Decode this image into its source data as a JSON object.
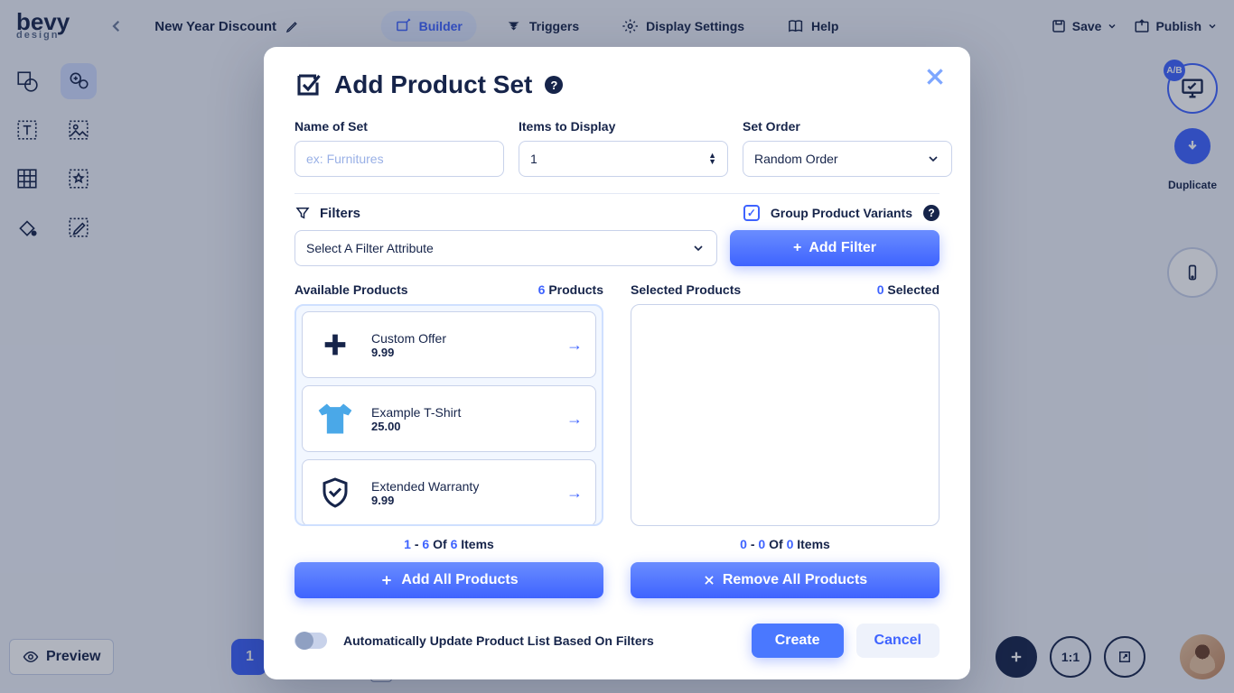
{
  "header": {
    "logo_main": "bevy",
    "logo_sub": "design",
    "campaign": "New Year Discount",
    "tabs": {
      "builder": "Builder",
      "triggers": "Triggers",
      "display": "Display Settings",
      "help": "Help"
    },
    "save": "Save",
    "publish": "Publish"
  },
  "right_dock": {
    "ab": "A/B",
    "duplicate": "Duplicate"
  },
  "bottom": {
    "preview": "Preview",
    "page": "1",
    "q": "?"
  },
  "modal": {
    "title": "Add Product Set",
    "labels": {
      "name": "Name of Set",
      "items": "Items to Display",
      "order": "Set Order"
    },
    "placeholders": {
      "name": "ex: Furnitures"
    },
    "values": {
      "items": "1",
      "order": "Random Order"
    },
    "filters_label": "Filters",
    "filter_select": "Select A Filter Attribute",
    "group_variants": "Group Product Variants",
    "add_filter": "Add Filter",
    "available": {
      "title": "Available Products",
      "count": "6",
      "unit": "Products"
    },
    "selected": {
      "title": "Selected Products",
      "count": "0",
      "unit": "Selected"
    },
    "products": [
      {
        "name": "Custom Offer",
        "price": "9.99",
        "icon": "plus"
      },
      {
        "name": "Example T-Shirt",
        "price": "25.00",
        "icon": "tshirt"
      },
      {
        "name": "Extended Warranty",
        "price": "9.99",
        "icon": "shield"
      }
    ],
    "pager_avail": {
      "from": "1",
      "to": "6",
      "of_word": "Of",
      "total": "6",
      "items_word": "Items"
    },
    "pager_sel": {
      "from": "0",
      "to": "0",
      "of_word": "Of",
      "total": "0",
      "items_word": "Items"
    },
    "add_all": "Add All Products",
    "remove_all": "Remove All Products",
    "auto_update": "Automatically Update Product List Based On Filters",
    "create": "Create",
    "cancel": "Cancel"
  }
}
